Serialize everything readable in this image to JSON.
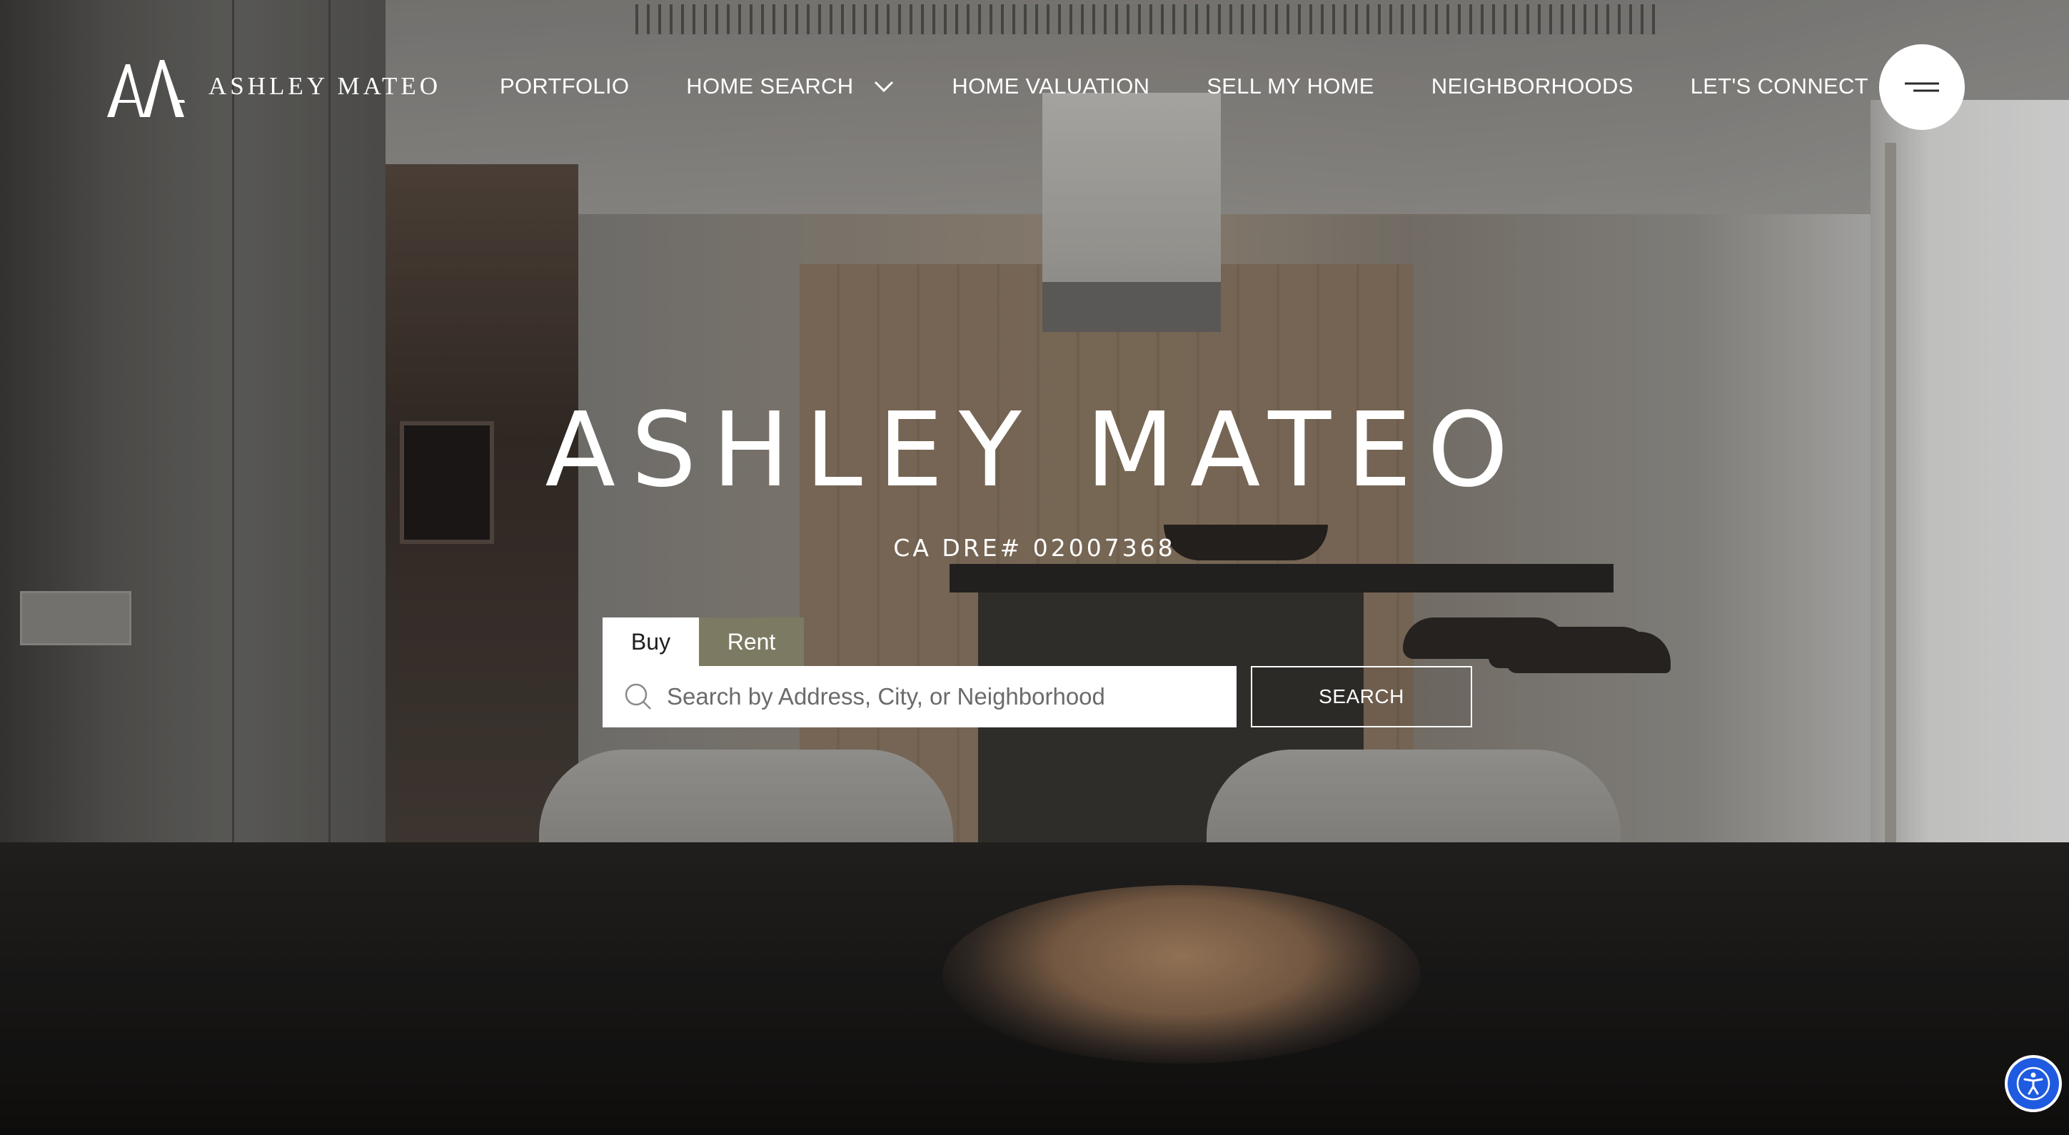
{
  "brand": {
    "logo_text": "ASHLEY MATEO",
    "logo_icon": "am-monogram-icon"
  },
  "nav": {
    "items": [
      {
        "label": "PORTFOLIO"
      },
      {
        "label": "HOME SEARCH",
        "has_dropdown": true
      },
      {
        "label": "HOME VALUATION"
      },
      {
        "label": "SELL MY HOME"
      },
      {
        "label": "NEIGHBORHOODS"
      },
      {
        "label": "LET'S CONNECT"
      }
    ],
    "menu_icon": "hamburger-menu-icon"
  },
  "hero": {
    "title": "ASHLEY MATEO",
    "subtitle": "CA DRE# 02007368"
  },
  "search": {
    "tabs": [
      {
        "label": "Buy",
        "active": true
      },
      {
        "label": "Rent",
        "active": false
      }
    ],
    "placeholder": "Search by Address, City, or Neighborhood",
    "value": "",
    "button_label": "SEARCH",
    "icon": "search-icon"
  },
  "accessibility": {
    "icon": "accessibility-icon"
  },
  "colors": {
    "accent_rent_tab": "#7c7a62",
    "text_light": "#ffffff",
    "accessibility_blue": "#1f5be0"
  }
}
